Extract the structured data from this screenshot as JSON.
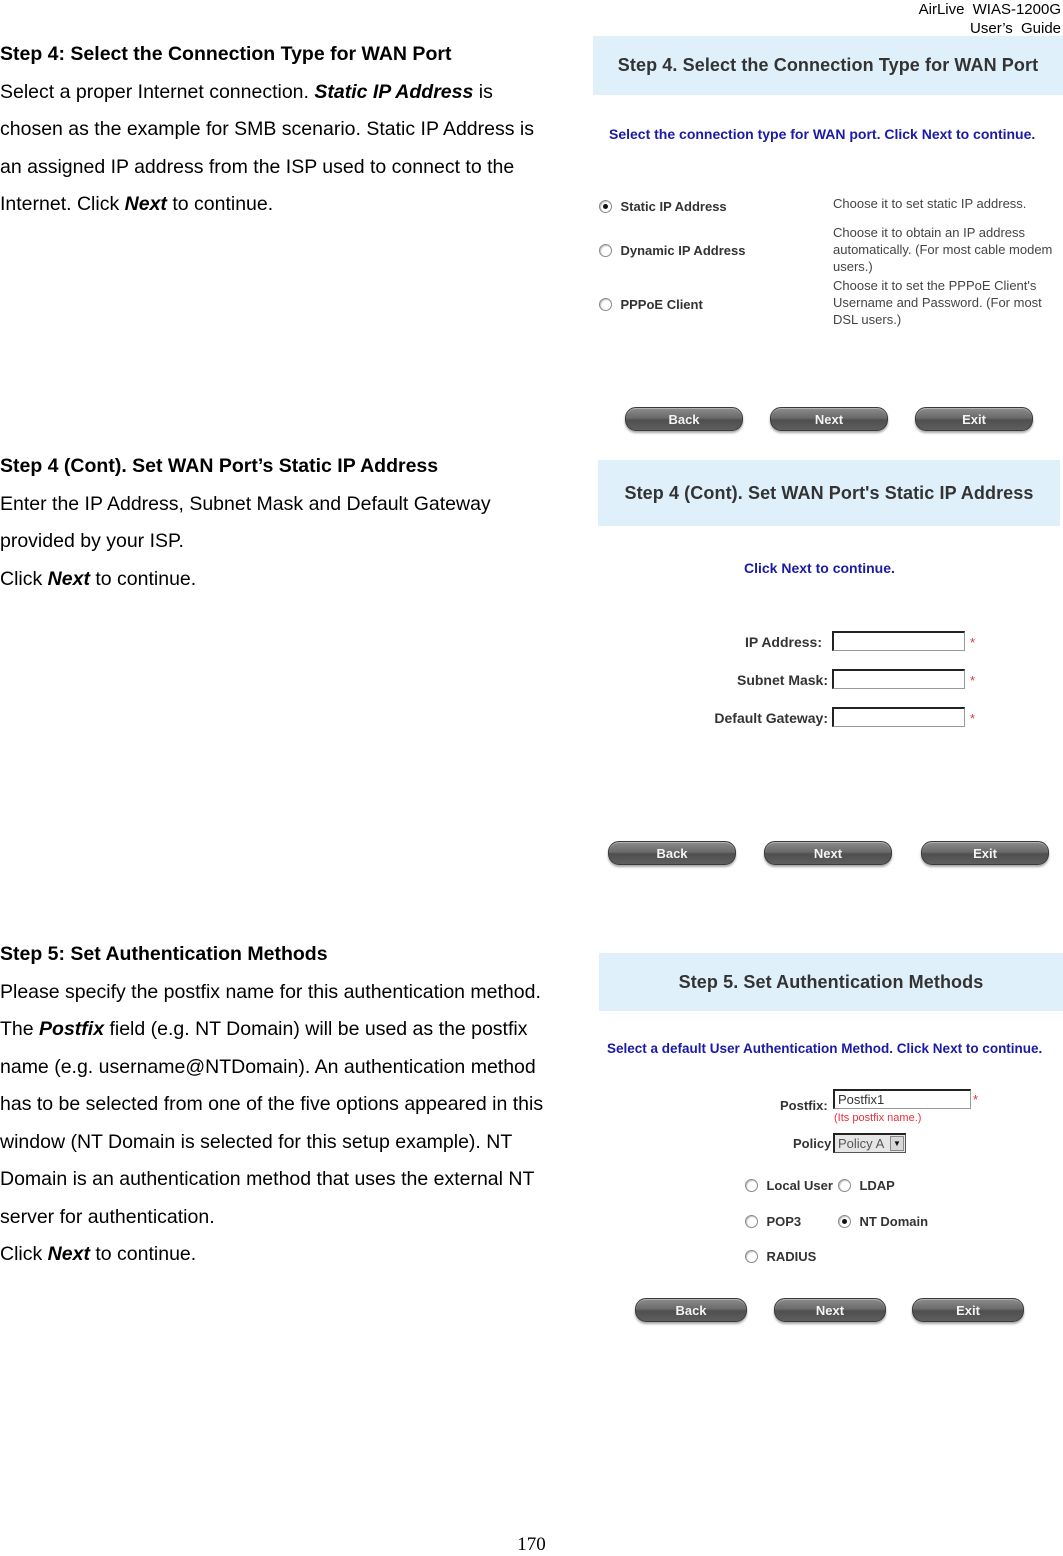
{
  "header": {
    "product": "AirLive  WIAS-1200G",
    "guide": "User’s  Guide"
  },
  "page_number": "170",
  "sections": {
    "step4": {
      "heading": "Step 4: Select the Connection Type for WAN Port",
      "body_1": "Select a proper Internet connection. ",
      "body_em_1": "Static IP Address",
      "body_2": " is",
      "line_2": "chosen as the example for SMB scenario. Static IP Address is",
      "line_3": "an assigned IP address from the ISP used to connect to the",
      "line_4_a": "Internet. Click ",
      "line_4_em": "Next",
      "line_4_b": " to continue."
    },
    "step4cont": {
      "heading": "Step 4 (Cont). Set WAN Port’s Static IP Address",
      "line_1": "Enter the IP Address, Subnet Mask and Default Gateway",
      "line_2": "provided by your ISP.",
      "line_3_a": "Click ",
      "line_3_em": "Next",
      "line_3_b": " to continue."
    },
    "step5": {
      "heading": "Step 5: Set Authentication Methods",
      "line_1": "Please specify the postfix name for this authentication method.",
      "line_2_a": "The ",
      "line_2_em": "Postfix",
      "line_2_b": " field (e.g. NT Domain) will be used as the postfix",
      "line_3": "name (e.g. username@NTDomain). An authentication method",
      "line_4": "has to be selected from one of the five options appeared in this",
      "line_5": "window (NT Domain is selected for this setup example). NT",
      "line_6": "Domain is an authentication method that uses the external NT",
      "line_7": "server for authentication.",
      "line_8_a": "Click ",
      "line_8_em": "Next",
      "line_8_b": " to continue."
    }
  },
  "screens": {
    "wan_type": {
      "title": "Step 4. Select the Connection Type for WAN Port",
      "instruction": "Select the connection type for WAN port. Click Next to continue.",
      "options": [
        {
          "label": "Static IP Address",
          "checked": true,
          "desc": [
            "Choose it to set static IP address."
          ]
        },
        {
          "label": "Dynamic IP Address",
          "checked": false,
          "desc": [
            "Choose it to obtain an IP address",
            "automatically. (For most cable modem",
            "users.)"
          ]
        },
        {
          "label": "PPPoE Client",
          "checked": false,
          "desc": [
            "Choose it to set the PPPoE Client's",
            "Username and Password. (For most",
            "DSL users.)"
          ]
        }
      ],
      "buttons": {
        "back": "Back",
        "next": "Next",
        "exit": "Exit"
      }
    },
    "static_ip": {
      "title": "Step 4 (Cont). Set WAN Port's Static IP Address",
      "instruction": "Click Next to continue.",
      "fields": [
        {
          "label": "IP Address:",
          "value": "",
          "required_mark": "*"
        },
        {
          "label": "Subnet Mask:",
          "value": "",
          "required_mark": "*"
        },
        {
          "label": "Default Gateway:",
          "value": "",
          "required_mark": "*"
        }
      ],
      "buttons": {
        "back": "Back",
        "next": "Next",
        "exit": "Exit"
      }
    },
    "auth": {
      "title": "Step 5. Set Authentication Methods",
      "instruction": "Select a default User Authentication Method. Click Next to continue.",
      "postfix_label": "Postfix:",
      "postfix_value": "Postfix1",
      "postfix_required": "*",
      "postfix_hint": "(Its postfix name.)",
      "policy_label": "Policy",
      "policy_value": "Policy A",
      "methods": [
        {
          "label": "Local User",
          "checked": false
        },
        {
          "label": "LDAP",
          "checked": false
        },
        {
          "label": "POP3",
          "checked": false
        },
        {
          "label": "NT Domain",
          "checked": true
        },
        {
          "label": "RADIUS",
          "checked": false
        }
      ],
      "buttons": {
        "back": "Back",
        "next": "Next",
        "exit": "Exit"
      }
    }
  },
  "colors": {
    "panel_title_bg": "#dff0fa",
    "instruction_text": "#1a1aa6",
    "required_mark": "#e8303c"
  }
}
